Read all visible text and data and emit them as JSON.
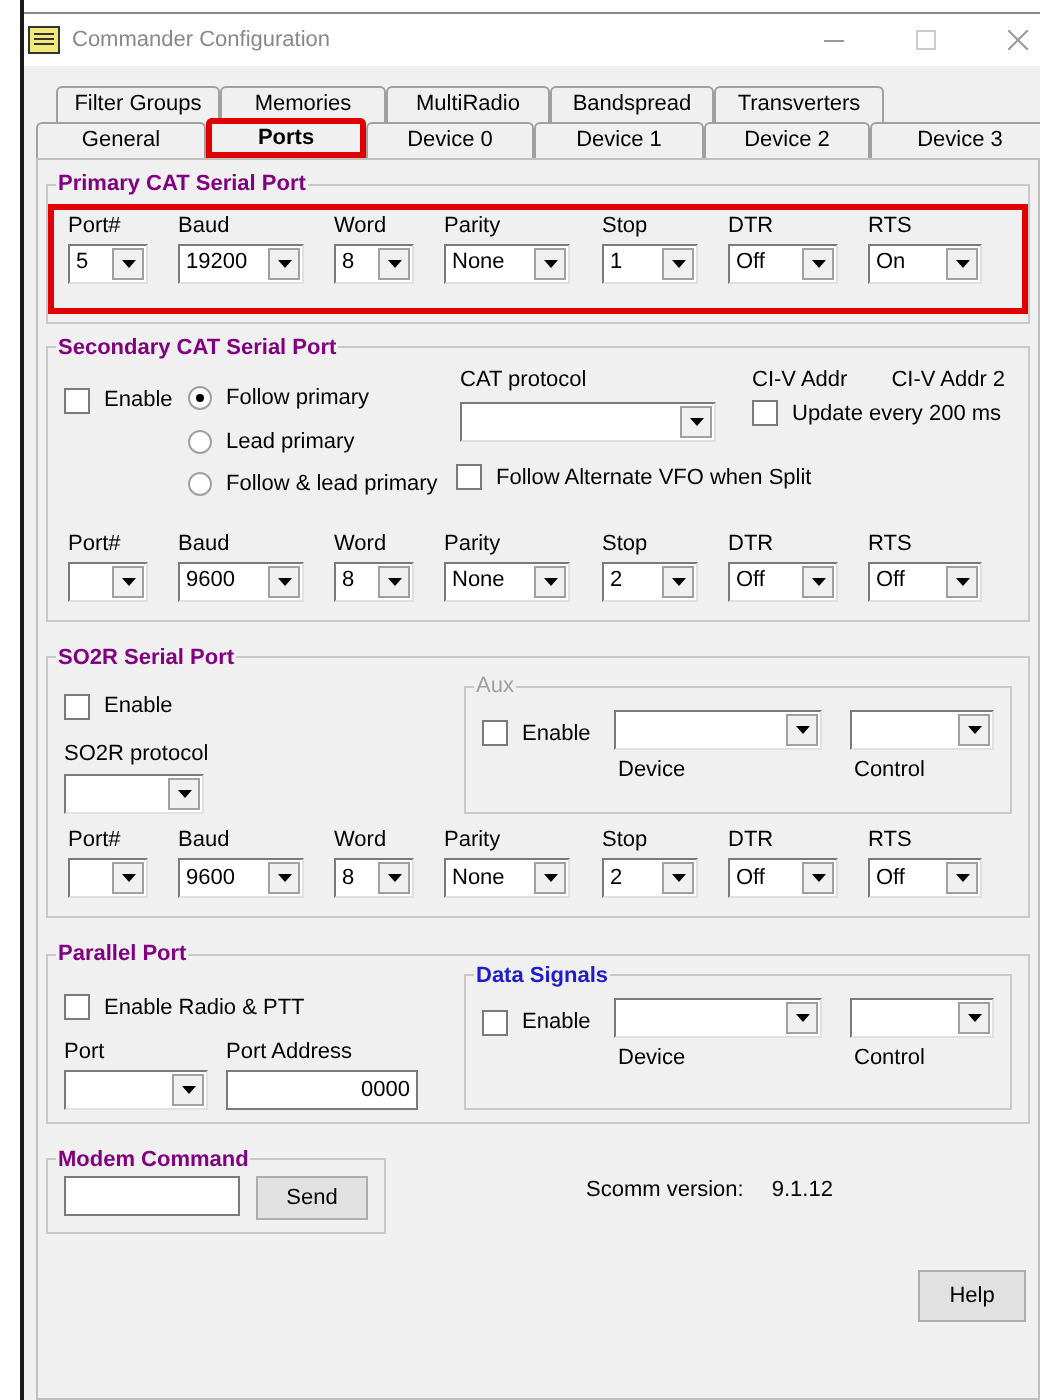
{
  "window": {
    "title": "Commander Configuration"
  },
  "tabs_back": [
    {
      "label": "Filter Groups",
      "selected": false
    },
    {
      "label": "Memories",
      "selected": false
    },
    {
      "label": "MultiRadio",
      "selected": false
    },
    {
      "label": "Bandspread",
      "selected": false
    },
    {
      "label": "Transverters",
      "selected": false
    }
  ],
  "tabs_front": [
    {
      "label": "General",
      "selected": false,
      "highlighted": false
    },
    {
      "label": "Ports",
      "selected": true,
      "highlighted": true
    },
    {
      "label": "Device 0",
      "selected": false,
      "highlighted": false
    },
    {
      "label": "Device 1",
      "selected": false,
      "highlighted": false
    },
    {
      "label": "Device 2",
      "selected": false,
      "highlighted": false
    },
    {
      "label": "Device 3",
      "selected": false,
      "highlighted": false
    }
  ],
  "primary": {
    "title": "Primary CAT Serial Port",
    "highlighted": true,
    "fields": [
      {
        "label": "Port#",
        "value": "5"
      },
      {
        "label": "Baud",
        "value": "19200"
      },
      {
        "label": "Word",
        "value": "8"
      },
      {
        "label": "Parity",
        "value": "None"
      },
      {
        "label": "Stop",
        "value": "1"
      },
      {
        "label": "DTR",
        "value": "Off"
      },
      {
        "label": "RTS",
        "value": "On"
      }
    ]
  },
  "secondary": {
    "title": "Secondary CAT Serial Port",
    "enable": {
      "label": "Enable",
      "checked": false
    },
    "modes": [
      {
        "label": "Follow primary",
        "selected": true
      },
      {
        "label": "Lead primary",
        "selected": false
      },
      {
        "label": "Follow & lead primary",
        "selected": false
      }
    ],
    "cat_protocol_label": "CAT protocol",
    "civ_addr_label": "CI-V Addr",
    "civ_addr2_label": "CI-V Addr 2",
    "update": {
      "label": "Update every 200 ms",
      "checked": false
    },
    "follow_alt": {
      "label": "Follow Alternate VFO when Split",
      "checked": false
    },
    "fields": [
      {
        "label": "Port#"
      },
      {
        "label": "Baud",
        "value": "9600"
      },
      {
        "label": "Word",
        "value": "8"
      },
      {
        "label": "Parity",
        "value": "None"
      },
      {
        "label": "Stop",
        "value": "2"
      },
      {
        "label": "DTR",
        "value": "Off"
      },
      {
        "label": "RTS",
        "value": "Off"
      }
    ]
  },
  "so2r": {
    "title": "SO2R Serial Port",
    "enable": {
      "label": "Enable",
      "checked": false
    },
    "protocol_label": "SO2R protocol",
    "aux": {
      "title": "Aux",
      "disabled": true,
      "enable": {
        "label": "Enable",
        "checked": false
      },
      "device_label": "Device",
      "control_label": "Control"
    },
    "fields": [
      {
        "label": "Port#"
      },
      {
        "label": "Baud",
        "value": "9600"
      },
      {
        "label": "Word",
        "value": "8"
      },
      {
        "label": "Parity",
        "value": "None"
      },
      {
        "label": "Stop",
        "value": "2"
      },
      {
        "label": "DTR",
        "value": "Off"
      },
      {
        "label": "RTS",
        "value": "Off"
      }
    ]
  },
  "parallel": {
    "title": "Parallel Port",
    "enable": {
      "label": "Enable Radio & PTT",
      "checked": false
    },
    "port_label": "Port",
    "address_label": "Port Address",
    "address_value": "0000",
    "data_signals": {
      "title": "Data Signals",
      "enable": {
        "label": "Enable",
        "checked": false
      },
      "device_label": "Device",
      "control_label": "Control"
    }
  },
  "modem": {
    "title": "Modem Command",
    "send": "Send"
  },
  "scomm": {
    "label": "Scomm version:",
    "value": "9.1.12"
  },
  "help": "Help"
}
